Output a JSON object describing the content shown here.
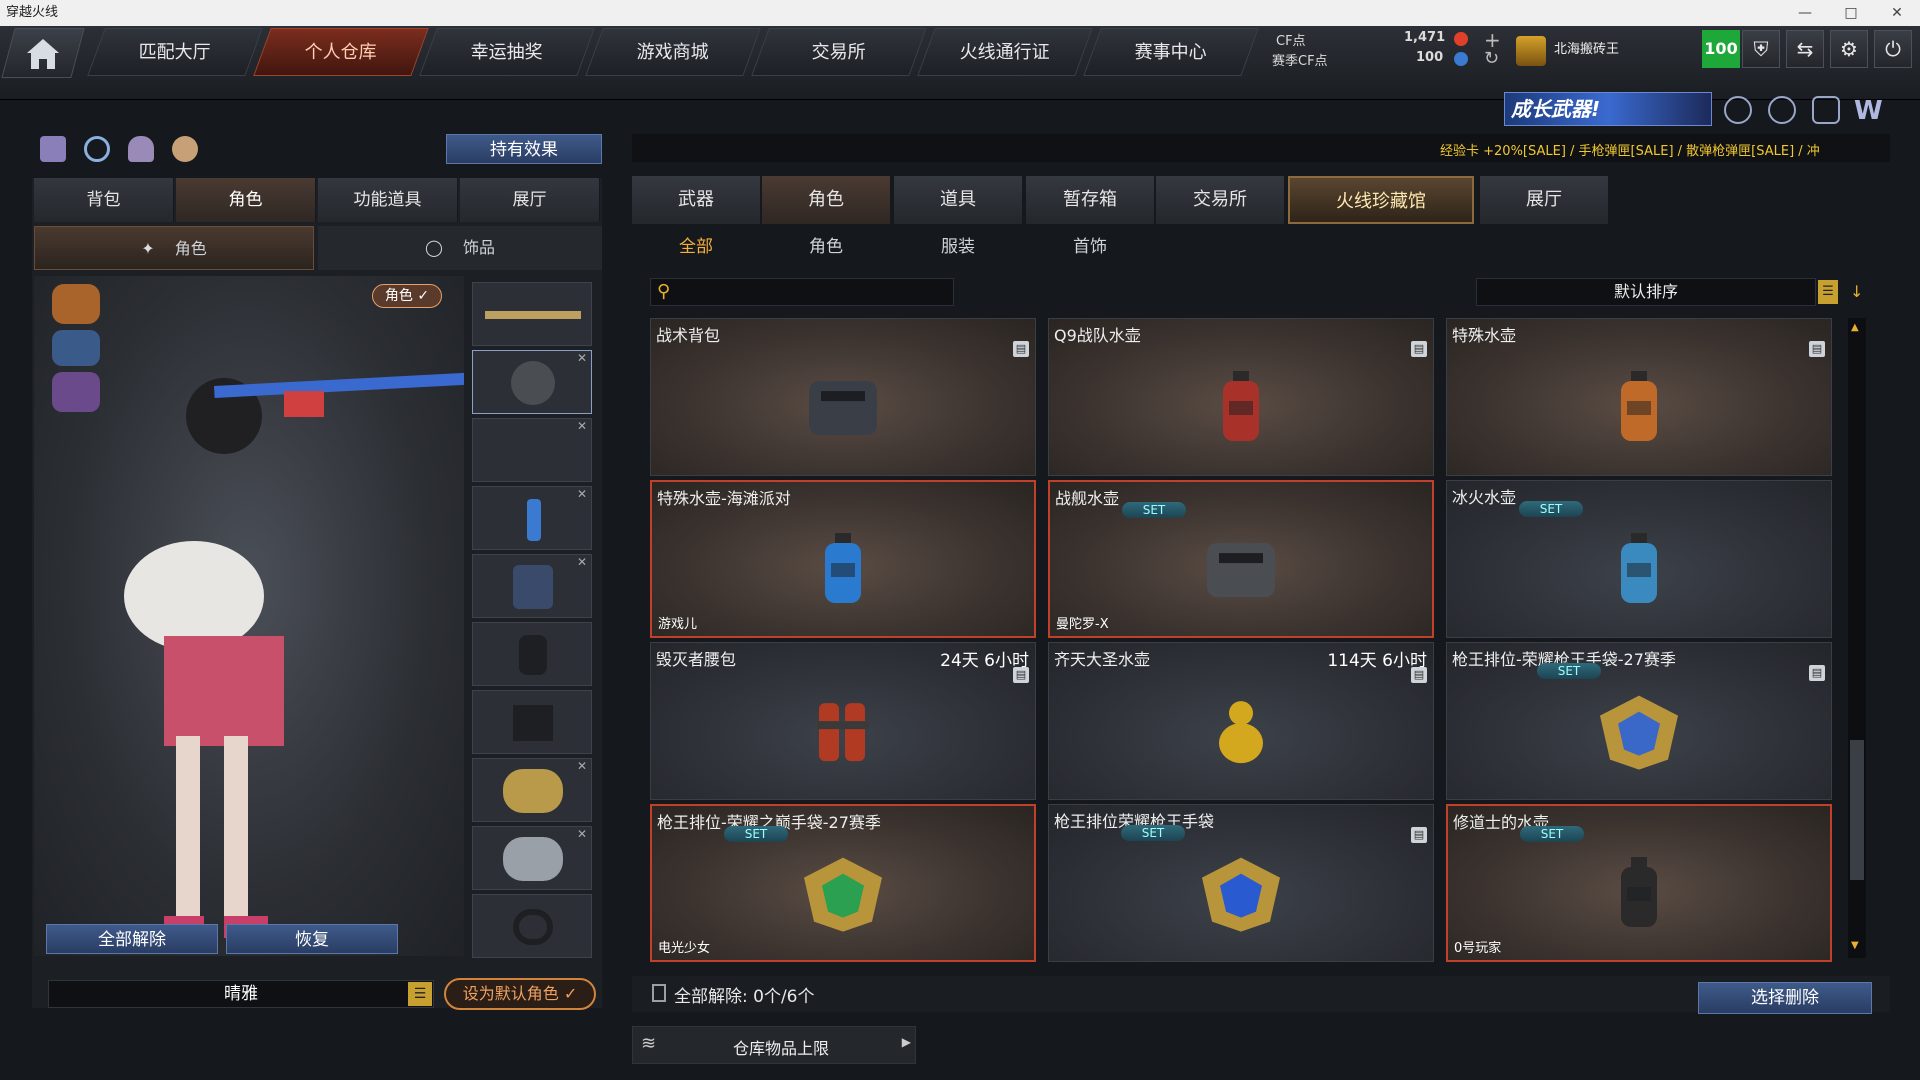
{
  "window": {
    "title": "穿越火线",
    "controls": [
      "—",
      "□",
      "✕"
    ]
  },
  "nav": {
    "tabs": [
      "匹配大厅",
      "个人仓库",
      "幸运抽奖",
      "游戏商城",
      "交易所",
      "火线通行证",
      "赛事中心"
    ],
    "active": "个人仓库"
  },
  "currency": {
    "cf_label": "CF点",
    "cf_value": "1,471",
    "season_label": "赛季CF点",
    "season_value": "100"
  },
  "player": {
    "name": "北海搬砖王",
    "level_badge": "100"
  },
  "banner": {
    "text": "成长武器!",
    "ticker": "经验卡 +20%[SALE] / 手枪弹匣[SALE] / 散弹枪弹匣[SALE] / 冲"
  },
  "left": {
    "effects_button": "持有效果",
    "tabs": [
      "背包",
      "角色",
      "功能道具",
      "展厅"
    ],
    "active_tab": "角色",
    "subtabs": [
      "角色",
      "饰品"
    ],
    "role_tag": "角色 ✓",
    "unequip_all": "全部解除",
    "restore": "恢复",
    "character_name": "晴雅",
    "set_default": "设为默认角色 ✓"
  },
  "right": {
    "tabs": [
      "武器",
      "角色",
      "道具",
      "暂存箱",
      "交易所",
      "火线珍藏馆",
      "展厅"
    ],
    "active_tab": "角色",
    "filters": [
      "全部",
      "角色",
      "服装",
      "首饰"
    ],
    "active_filter": "全部",
    "search_placeholder": "",
    "sort_label": "默认排序",
    "items": [
      {
        "name": "战术背包",
        "time": "",
        "set": false,
        "owner": "",
        "border": false,
        "lock": true,
        "icon": "backpack-icon",
        "color": "#3a3f47"
      },
      {
        "name": "Q9战队水壶",
        "time": "",
        "set": false,
        "owner": "",
        "border": false,
        "lock": true,
        "icon": "canteen-icon",
        "color": "#a8322a"
      },
      {
        "name": "特殊水壶",
        "time": "",
        "set": false,
        "owner": "",
        "border": false,
        "lock": true,
        "icon": "canteen-icon",
        "color": "#c06a2a"
      },
      {
        "name": "特殊水壶-海滩派对",
        "time": "",
        "set": false,
        "owner": "游戏儿",
        "border": true,
        "lock": false,
        "icon": "bottle-icon",
        "color": "#2a7ad0"
      },
      {
        "name": "战舰水壶",
        "time": "",
        "set": true,
        "owner": "曼陀罗-X",
        "border": true,
        "lock": false,
        "icon": "armored-canteen-icon",
        "color": "#4a4d52"
      },
      {
        "name": "冰火水壶",
        "time": "",
        "set": true,
        "owner": "",
        "border": false,
        "lock": false,
        "icon": "canteen-icon",
        "color": "#3a8ac0"
      },
      {
        "name": "毁灭者腰包",
        "time": "24天 6小时",
        "set": false,
        "owner": "",
        "border": false,
        "lock": true,
        "icon": "waist-pack-icon",
        "color": "#b03a22"
      },
      {
        "name": "齐天大圣水壶",
        "time": "114天 6小时",
        "set": false,
        "owner": "",
        "border": false,
        "lock": true,
        "icon": "gourd-icon",
        "color": "#d4a81e"
      },
      {
        "name": "枪王排位-荣耀枪王手袋-27赛季",
        "time": "",
        "set": true,
        "owner": "",
        "border": false,
        "lock": true,
        "icon": "rank-emblem-icon",
        "color": "#3a68c8"
      },
      {
        "name": "枪王排位-荣耀之巅手袋-27赛季",
        "time": "",
        "set": true,
        "owner": "电光少女",
        "border": true,
        "lock": false,
        "icon": "rank-emblem-icon",
        "color": "#2aa050"
      },
      {
        "name": "枪王排位荣耀枪王手袋",
        "time": "",
        "set": true,
        "owner": "",
        "border": false,
        "lock": true,
        "icon": "rank-emblem-icon",
        "color": "#2a5ad0"
      },
      {
        "name": "修道士的水壶",
        "time": "",
        "set": true,
        "owner": "0号玩家",
        "border": true,
        "lock": false,
        "icon": "flask-icon",
        "color": "#2a2a2a"
      }
    ],
    "bulk": "全部解除: 0个/6个",
    "select_delete": "选择删除",
    "capacity": "仓库物品上限"
  },
  "labels": {
    "set": "SET"
  }
}
